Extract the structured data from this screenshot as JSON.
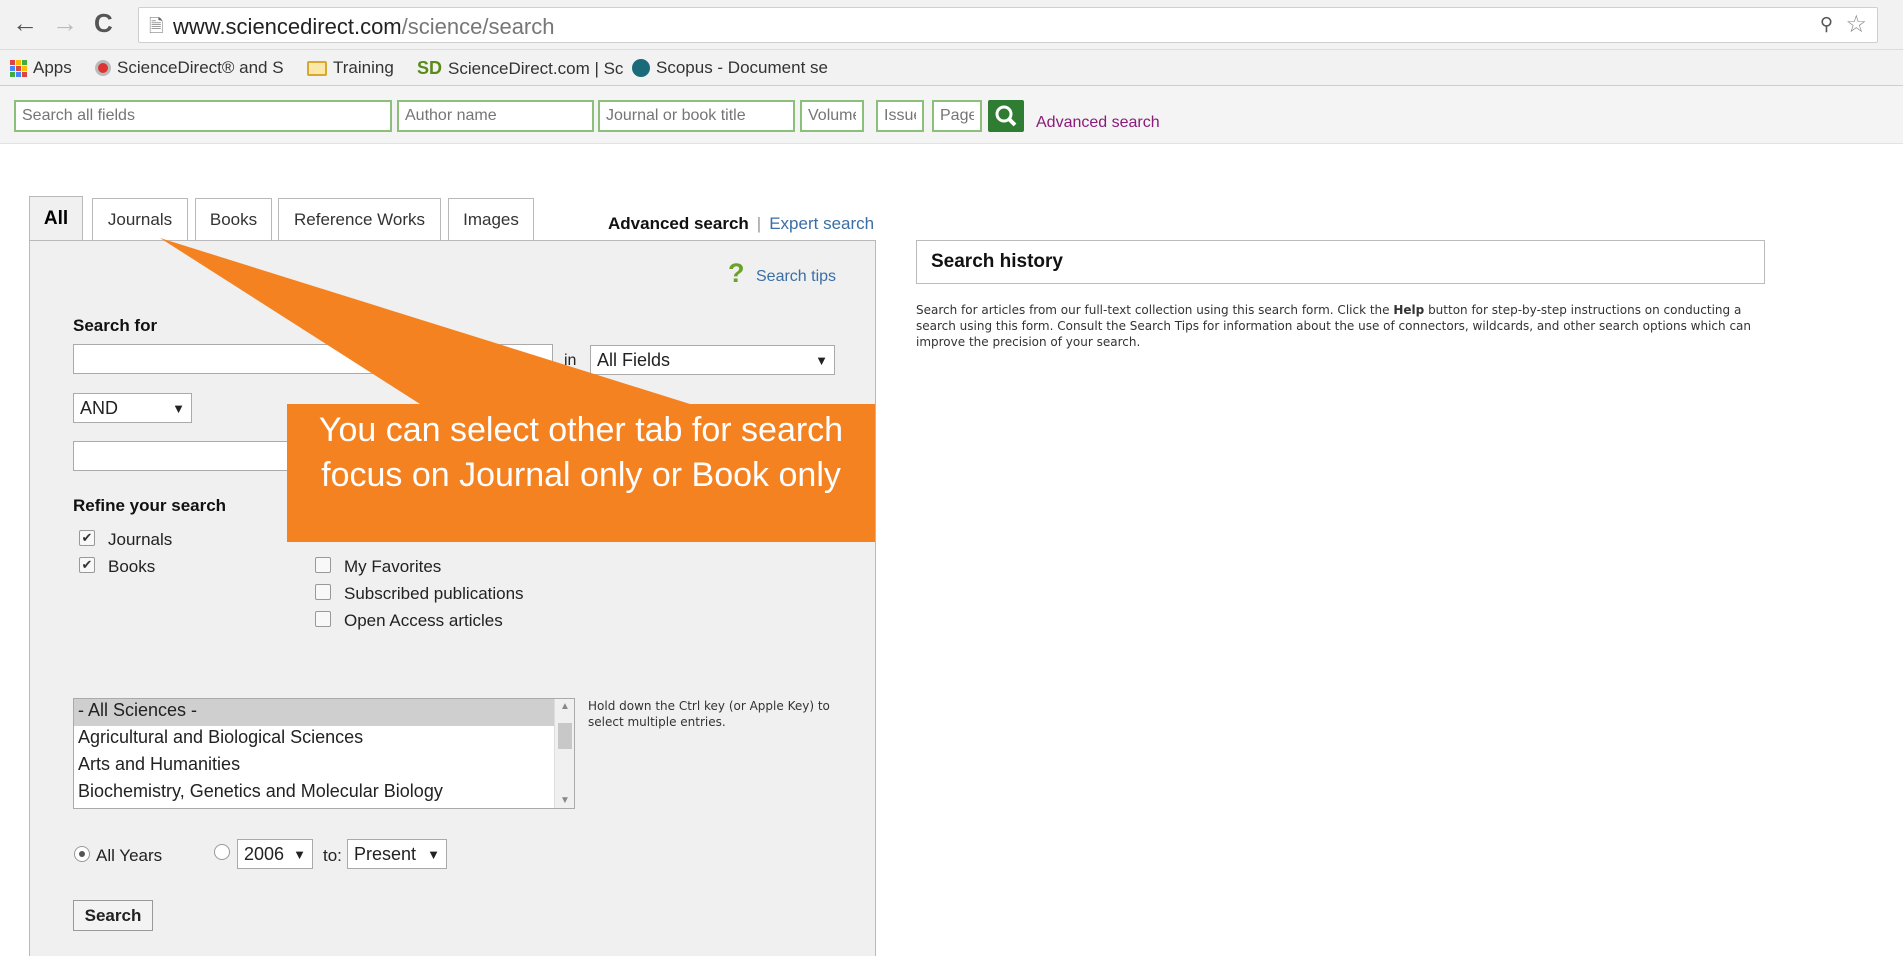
{
  "browser": {
    "back_icon": "arrow-left-icon",
    "forward_icon": "arrow-right-icon",
    "reload_icon": "reload-icon",
    "url_host": "www.sciencedirect.com",
    "url_path": "/science/search"
  },
  "bookmarks": [
    {
      "label": "Apps",
      "icon": "apps-grid-icon"
    },
    {
      "label": "ScienceDirect® and S",
      "icon": "sd-favicon-icon"
    },
    {
      "label": "Training",
      "icon": "folder-icon"
    },
    {
      "label": "ScienceDirect.com | Sc",
      "icon": "sd-logo-icon"
    },
    {
      "label": "Scopus - Document se",
      "icon": "scopus-icon"
    }
  ],
  "quick_search": {
    "all_fields_placeholder": "Search all fields",
    "author_placeholder": "Author name",
    "journal_placeholder": "Journal or book title",
    "volume_placeholder": "Volume",
    "issue_placeholder": "Issue",
    "page_placeholder": "Page",
    "advanced_link": "Advanced search"
  },
  "tabs": [
    {
      "label": "All",
      "active": true
    },
    {
      "label": "Journals"
    },
    {
      "label": "Books"
    },
    {
      "label": "Reference Works"
    },
    {
      "label": "Images"
    }
  ],
  "panel_links": {
    "advanced": "Advanced search",
    "separator": "|",
    "expert": "Expert search"
  },
  "form": {
    "search_tips": "Search tips",
    "search_for": "Search for",
    "in_label": "in",
    "field_select": "All Fields",
    "operator": "AND",
    "refine_title": "Refine your search",
    "refine_left": [
      {
        "label": "Journals",
        "checked": true
      },
      {
        "label": "Books",
        "checked": true
      }
    ],
    "refine_right": [
      {
        "label": "My Favorites",
        "checked": false
      },
      {
        "label": "Subscribed publications",
        "checked": false
      },
      {
        "label": "Open Access articles",
        "checked": false
      }
    ],
    "subjects": [
      "- All Sciences -",
      "Agricultural and Biological Sciences",
      "Arts and Humanities",
      "Biochemistry, Genetics and Molecular Biology"
    ],
    "subject_hint": "Hold down the Ctrl key (or Apple Key) to select multiple entries.",
    "all_years": "All Years",
    "year_from": "2006",
    "to_label": "to:",
    "year_to": "Present",
    "search_button": "Search"
  },
  "history": {
    "title": "Search history",
    "help_before": "Search for articles from our full-text collection using this search form. Click the ",
    "help_bold": "Help",
    "help_after": " button for step-by-step instructions on conducting a search using this form. Consult the Search Tips for information about the use of connectors, wildcards, and other search options which can improve the precision of your search."
  },
  "callout": {
    "text": "You can select other tab for search focus on Journal only or Book only",
    "color": "#f58220"
  }
}
